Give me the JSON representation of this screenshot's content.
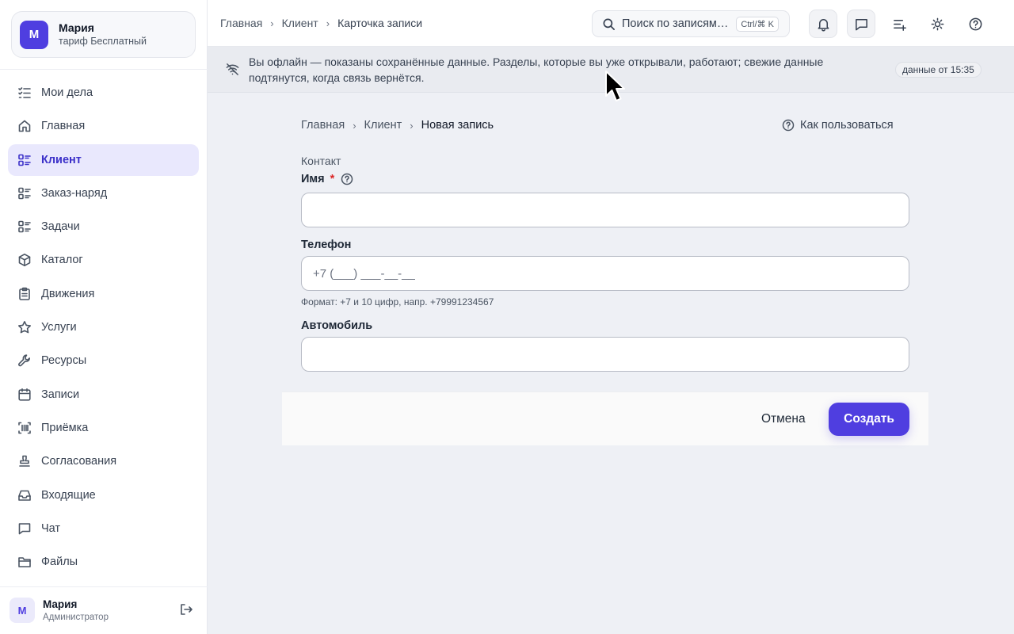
{
  "account": {
    "initial": "М",
    "name": "Мария",
    "plan": "тариф Бесплатный"
  },
  "sidebar": {
    "items": [
      {
        "label": "Мои дела",
        "icon": "task-list-icon"
      },
      {
        "label": "Главная",
        "icon": "home-icon"
      },
      {
        "label": "Клиент",
        "icon": "list-icon",
        "active": true
      },
      {
        "label": "Заказ-наряд",
        "icon": "list-icon"
      },
      {
        "label": "Задачи",
        "icon": "list-icon"
      },
      {
        "label": "Каталог",
        "icon": "box-icon"
      },
      {
        "label": "Движения",
        "icon": "clipboard-icon"
      },
      {
        "label": "Услуги",
        "icon": "star-icon"
      },
      {
        "label": "Ресурсы",
        "icon": "wrench-icon"
      },
      {
        "label": "Записи",
        "icon": "calendar-icon"
      },
      {
        "label": "Приёмка",
        "icon": "barcode-scan-icon"
      },
      {
        "label": "Согласования",
        "icon": "stamp-icon"
      },
      {
        "label": "Входящие",
        "icon": "inbox-icon"
      },
      {
        "label": "Чат",
        "icon": "chat-icon"
      },
      {
        "label": "Файлы",
        "icon": "folder-icon"
      }
    ]
  },
  "user": {
    "initial": "М",
    "name": "Мария",
    "role": "Администратор"
  },
  "topbar": {
    "breadcrumb": [
      "Главная",
      "Клиент",
      "Карточка записи"
    ],
    "search_placeholder": "Поиск по записям…",
    "search_shortcut": "Ctrl/⌘ K"
  },
  "banner": {
    "text": "Вы офлайн — показаны сохранённые данные. Разделы, которые вы уже открывали, работают; свежие данные подтянутся, когда связь вернётся.",
    "badge": "данные от 15:35"
  },
  "form": {
    "breadcrumb": [
      "Главная",
      "Клиент",
      "Новая запись"
    ],
    "howto_label": "Как пользоваться",
    "section_title": "Контакт",
    "fields": {
      "name": {
        "label": "Имя",
        "required_mark": "*",
        "value": "",
        "placeholder": ""
      },
      "phone": {
        "label": "Телефон",
        "value": "",
        "placeholder": "+7 (___) ___-__-__",
        "hint": "Формат: +7 и 10 цифр, напр. +79991234567"
      },
      "car": {
        "label": "Автомобиль",
        "value": "",
        "placeholder": ""
      }
    },
    "cancel_label": "Отмена",
    "create_label": "Создать"
  },
  "colors": {
    "accent": "#4f3ee0",
    "active_bg": "#e9e8fd",
    "required": "#dc2626"
  }
}
